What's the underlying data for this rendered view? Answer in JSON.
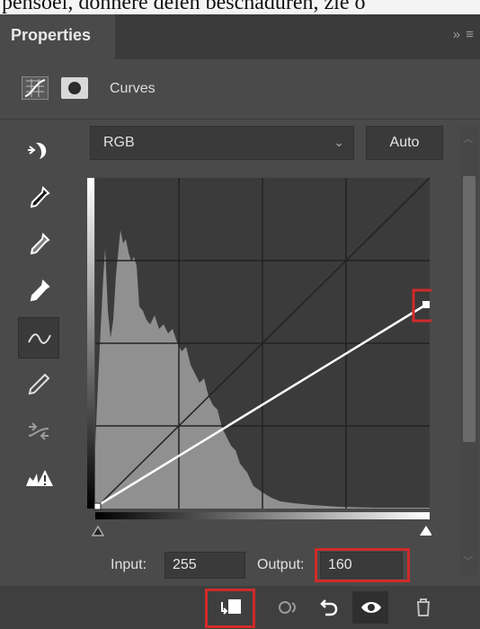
{
  "top_text": "pensoel, donnere delen beschaduren, zie o",
  "tab": {
    "label": "Properties",
    "controls": "»  ≡"
  },
  "header": {
    "title": "Curves"
  },
  "tools": [
    "curve-target-icon",
    "black-point-eyedropper-icon",
    "gray-point-eyedropper-icon",
    "white-point-eyedropper-icon",
    "curve-point-icon",
    "pencil-icon",
    "smooth-icon",
    "clipping-warning-icon"
  ],
  "channel": {
    "value": "RGB"
  },
  "auto_button": {
    "label": "Auto"
  },
  "input": {
    "label": "Input:",
    "value": "255"
  },
  "output": {
    "label": "Output:",
    "value": "160"
  },
  "highlight_color": "#d12a2a",
  "bottom_buttons": [
    "clip-to-layer-icon",
    "view-previous-icon",
    "reset-icon",
    "visibility-icon",
    "delete-icon"
  ]
}
